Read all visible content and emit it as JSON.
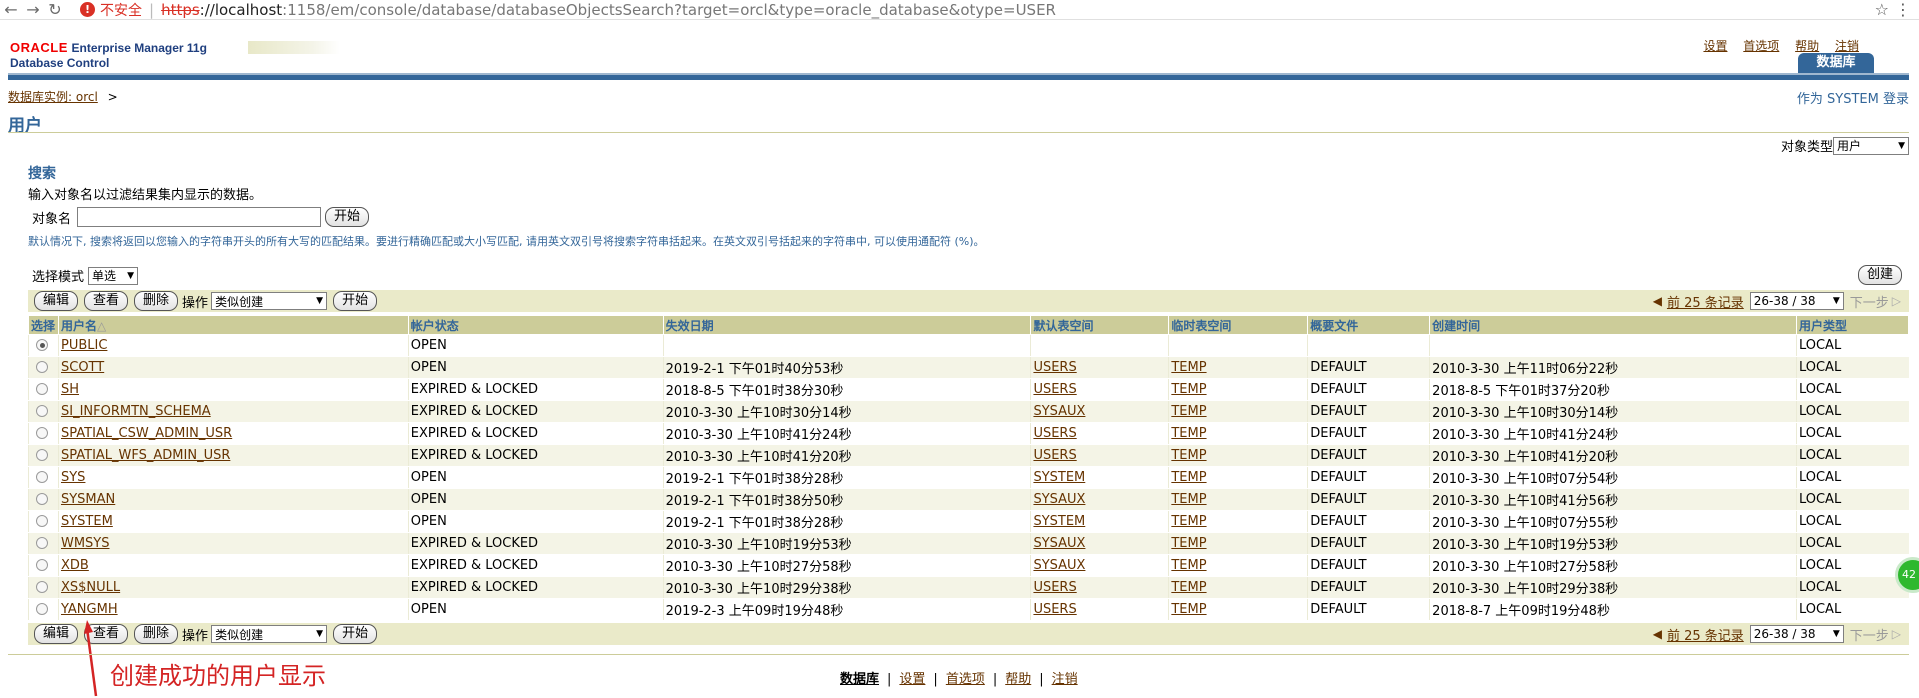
{
  "browser": {
    "insecure_label": "不安全",
    "url_https": "https",
    "url_host": "://localhost",
    "url_rest": ":1158/em/console/database/databaseObjectsSearch?target=orcl&type=oracle_database&otype=USER"
  },
  "header": {
    "oracle": "ORACLE",
    "product": "Enterprise Manager 11g",
    "subtitle": "Database Control",
    "links": [
      "设置",
      "首选项",
      "帮助",
      "注销"
    ],
    "tab": "数据库"
  },
  "breadcrumb": {
    "link": "数据库实例: orcl",
    "sep": ">"
  },
  "login_as": "作为 SYSTEM 登录",
  "page_title": "用户",
  "object_type": {
    "label": "对象类型",
    "value": "用户"
  },
  "search": {
    "heading": "搜索",
    "description": "输入对象名以过滤结果集内显示的数据。",
    "field_label": "对象名",
    "field_value": "",
    "go_label": "开始",
    "tip": "默认情况下, 搜索将返回以您输入的字符串开头的所有大写的匹配结果。要进行精确匹配或大小写匹配, 请用英文双引号将搜索字符串括起来。在英文双引号括起来的字符串中, 可以使用通配符 (%)。"
  },
  "select_mode": {
    "label": "选择模式",
    "value": "单选"
  },
  "create_label": "创建",
  "toolbar": {
    "edit": "编辑",
    "view": "查看",
    "delete": "删除",
    "action_label": "操作",
    "action_value": "类似创建",
    "go": "开始",
    "prev": "前 25 条记录",
    "range": "26-38 / 38",
    "next": "下一步"
  },
  "table": {
    "headers": [
      "选择",
      "用户名",
      "帐户状态",
      "失效日期",
      "默认表空间",
      "临时表空间",
      "概要文件",
      "创建时间",
      "用户类型"
    ],
    "sort_indicator": "△",
    "rows": [
      {
        "name": "PUBLIC",
        "status": "OPEN",
        "expire": "",
        "default_ts": "",
        "temp_ts": "",
        "profile": "",
        "created": "",
        "type": "LOCAL",
        "selected": true
      },
      {
        "name": "SCOTT",
        "status": "OPEN",
        "expire": "2019-2-1 下午01时40分53秒",
        "default_ts": "USERS",
        "temp_ts": "TEMP",
        "profile": "DEFAULT",
        "created": "2010-3-30 上午11时06分22秒",
        "type": "LOCAL",
        "selected": false
      },
      {
        "name": "SH",
        "status": "EXPIRED & LOCKED",
        "expire": "2018-8-5 下午01时38分30秒",
        "default_ts": "USERS",
        "temp_ts": "TEMP",
        "profile": "DEFAULT",
        "created": "2018-8-5 下午01时37分20秒",
        "type": "LOCAL",
        "selected": false
      },
      {
        "name": "SI_INFORMTN_SCHEMA",
        "status": "EXPIRED & LOCKED",
        "expire": "2010-3-30 上午10时30分14秒",
        "default_ts": "SYSAUX",
        "temp_ts": "TEMP",
        "profile": "DEFAULT",
        "created": "2010-3-30 上午10时30分14秒",
        "type": "LOCAL",
        "selected": false
      },
      {
        "name": "SPATIAL_CSW_ADMIN_USR",
        "status": "EXPIRED & LOCKED",
        "expire": "2010-3-30 上午10时41分24秒",
        "default_ts": "USERS",
        "temp_ts": "TEMP",
        "profile": "DEFAULT",
        "created": "2010-3-30 上午10时41分24秒",
        "type": "LOCAL",
        "selected": false
      },
      {
        "name": "SPATIAL_WFS_ADMIN_USR",
        "status": "EXPIRED & LOCKED",
        "expire": "2010-3-30 上午10时41分20秒",
        "default_ts": "USERS",
        "temp_ts": "TEMP",
        "profile": "DEFAULT",
        "created": "2010-3-30 上午10时41分20秒",
        "type": "LOCAL",
        "selected": false
      },
      {
        "name": "SYS",
        "status": "OPEN",
        "expire": "2019-2-1 下午01时38分28秒",
        "default_ts": "SYSTEM",
        "temp_ts": "TEMP",
        "profile": "DEFAULT",
        "created": "2010-3-30 上午10时07分54秒",
        "type": "LOCAL",
        "selected": false
      },
      {
        "name": "SYSMAN",
        "status": "OPEN",
        "expire": "2019-2-1 下午01时38分50秒",
        "default_ts": "SYSAUX",
        "temp_ts": "TEMP",
        "profile": "DEFAULT",
        "created": "2010-3-30 上午10时41分56秒",
        "type": "LOCAL",
        "selected": false
      },
      {
        "name": "SYSTEM",
        "status": "OPEN",
        "expire": "2019-2-1 下午01时38分28秒",
        "default_ts": "SYSTEM",
        "temp_ts": "TEMP",
        "profile": "DEFAULT",
        "created": "2010-3-30 上午10时07分55秒",
        "type": "LOCAL",
        "selected": false
      },
      {
        "name": "WMSYS",
        "status": "EXPIRED & LOCKED",
        "expire": "2010-3-30 上午10时19分53秒",
        "default_ts": "SYSAUX",
        "temp_ts": "TEMP",
        "profile": "DEFAULT",
        "created": "2010-3-30 上午10时19分53秒",
        "type": "LOCAL",
        "selected": false
      },
      {
        "name": "XDB",
        "status": "EXPIRED & LOCKED",
        "expire": "2010-3-30 上午10时27分58秒",
        "default_ts": "SYSAUX",
        "temp_ts": "TEMP",
        "profile": "DEFAULT",
        "created": "2010-3-30 上午10时27分58秒",
        "type": "LOCAL",
        "selected": false
      },
      {
        "name": "XS$NULL",
        "status": "EXPIRED & LOCKED",
        "expire": "2010-3-30 上午10时29分38秒",
        "default_ts": "USERS",
        "temp_ts": "TEMP",
        "profile": "DEFAULT",
        "created": "2010-3-30 上午10时29分38秒",
        "type": "LOCAL",
        "selected": false
      },
      {
        "name": "YANGMH",
        "status": "OPEN",
        "expire": "2019-2-3 上午09时19分48秒",
        "default_ts": "USERS",
        "temp_ts": "TEMP",
        "profile": "DEFAULT",
        "created": "2018-8-7 上午09时19分48秒",
        "type": "LOCAL",
        "selected": false
      }
    ]
  },
  "annotation": "创建成功的用户显示",
  "footer_links": [
    "数据库",
    "设置",
    "首选项",
    "帮助",
    "注销"
  ],
  "colors": {
    "brand_blue": "#336699",
    "oracle_red": "#f00000",
    "table_header": "#cccc99",
    "toolbar": "#eaeac9",
    "annotation_red": "#d42424"
  }
}
